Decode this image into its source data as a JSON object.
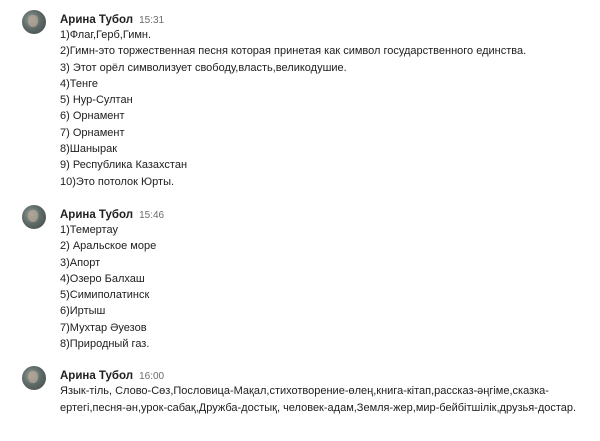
{
  "messages": [
    {
      "author": "Арина Тубол",
      "time": "15:31",
      "lines": [
        "1)Флаг,Герб,Гимн.",
        "2)Гимн-это торжественная песня которая принетая как символ государственного единства.",
        "3) Этот орёл символизует свободу,власть,великодушие.",
        "4)Тенге",
        "5) Нур-Султан",
        "6) Орнамент",
        "7) Орнамент",
        "8)Шанырак",
        "9) Республика Казахстан",
        "10)Это потолок Юрты."
      ]
    },
    {
      "author": "Арина Тубол",
      "time": "15:46",
      "lines": [
        "1)Темертау",
        "2) Аральское море",
        "3)Апорт",
        "4)Озеро Балхаш",
        "5)Симиполатинск",
        "6)Иртыш",
        "7)Мухтар Әуезов",
        "8)Природный газ."
      ]
    },
    {
      "author": "Арина Тубол",
      "time": "16:00",
      "text": "Язык-тіль, Слово-Сөз,Пословица-Мақал,стихотворение-өлең,книга-кітап,рассказ-әңгіме,сказка-ертегі,песня-ән,урок-сабақ,Дружба-достық, человек-адам,Земля-жер,мир-бейбітшілік,друзья-достар."
    }
  ]
}
